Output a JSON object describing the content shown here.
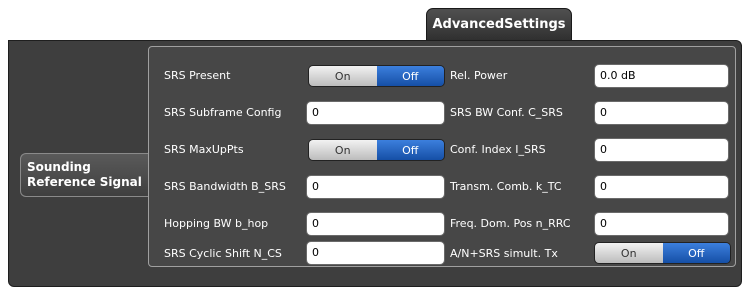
{
  "tab": {
    "label": "AdvancedSettings"
  },
  "section": {
    "label": "Sounding Reference Signal"
  },
  "toggle_labels": {
    "on": "On",
    "off": "Off"
  },
  "left": [
    {
      "label": "SRS Present",
      "value": null,
      "state": "Off"
    },
    {
      "label": "SRS Subframe Config",
      "value": "0"
    },
    {
      "label": "SRS MaxUpPts",
      "value": null,
      "state": "Off"
    },
    {
      "label": "SRS Bandwidth B_SRS",
      "value": "0"
    },
    {
      "label": "Hopping BW b_hop",
      "value": "0"
    },
    {
      "label": "SRS Cyclic Shift N_CS",
      "value": "0"
    }
  ],
  "right": [
    {
      "label": "Rel. Power",
      "value": "0.0 dB"
    },
    {
      "label": "SRS BW Conf. C_SRS",
      "value": "0"
    },
    {
      "label": "Conf. Index I_SRS",
      "value": "0"
    },
    {
      "label": "Transm. Comb. k_TC",
      "value": "0"
    },
    {
      "label": "Freq. Dom. Pos n_RRC",
      "value": "0"
    },
    {
      "label": "A/N+SRS simult. Tx",
      "value": null,
      "state": "Off"
    }
  ],
  "colors": {
    "accent": "#1f5fc0",
    "frame": "#3e3e3e",
    "panel": "#474747"
  }
}
